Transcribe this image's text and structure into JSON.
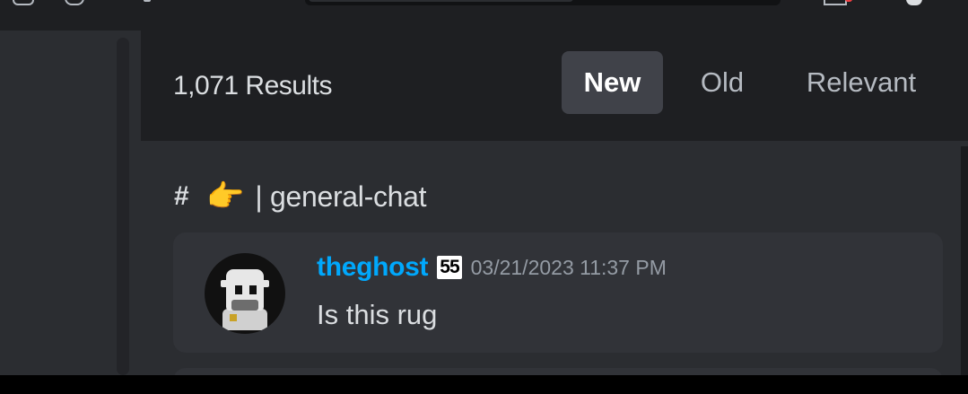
{
  "results": {
    "count_label": "1,071 Results",
    "sort_tabs": [
      {
        "label": "New",
        "active": true
      },
      {
        "label": "Old",
        "active": false
      },
      {
        "label": "Relevant",
        "active": false
      }
    ]
  },
  "channel": {
    "hash_icon": "#",
    "emoji": "👉",
    "separator": "|",
    "name": "general-chat"
  },
  "message": {
    "author": "theghost",
    "tag": "55",
    "timestamp": "03/21/2023 11:37 PM",
    "text": "Is this rug"
  },
  "colors": {
    "username": "#00a8fc",
    "active_tab_bg": "#404249",
    "card_bg": "#313338"
  }
}
